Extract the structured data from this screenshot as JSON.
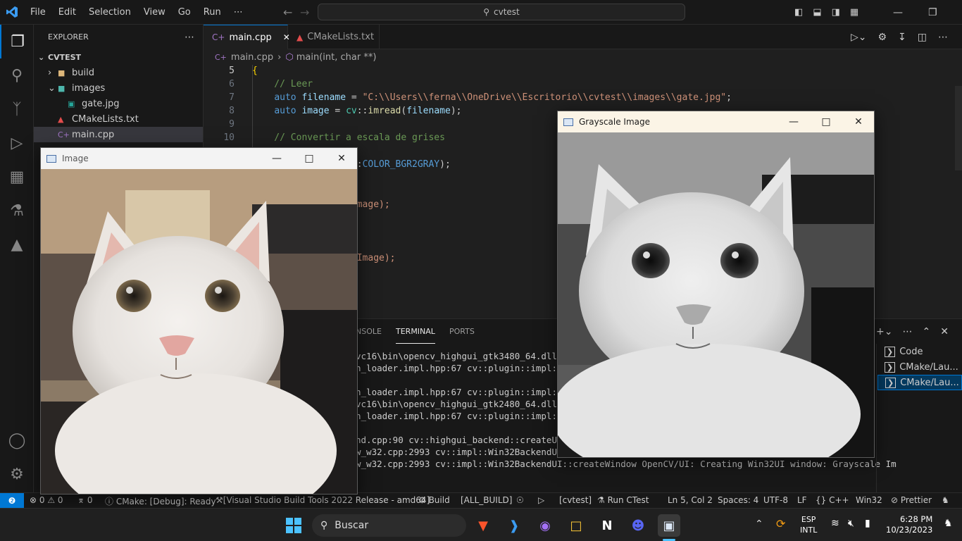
{
  "titlebar": {
    "menu": [
      "File",
      "Edit",
      "Selection",
      "View",
      "Go",
      "Run",
      "⋯"
    ],
    "search": "cvtest"
  },
  "sidebar": {
    "title": "EXPLORER",
    "root": "CVTEST",
    "items": [
      {
        "label": "build",
        "icon": "folder-icon",
        "indent": 1,
        "chevron": "›"
      },
      {
        "label": "images",
        "icon": "image-folder-icon",
        "indent": 1,
        "chevron": "⌄"
      },
      {
        "label": "gate.jpg",
        "icon": "image-file-icon",
        "indent": 2
      },
      {
        "label": "CMakeLists.txt",
        "icon": "cmake-icon",
        "indent": 1
      },
      {
        "label": "main.cpp",
        "icon": "cpp-icon",
        "indent": 1,
        "selected": true
      }
    ]
  },
  "tabs": [
    {
      "label": "main.cpp",
      "active": true
    },
    {
      "label": "CMakeLists.txt",
      "active": false
    }
  ],
  "breadcrumbs": [
    "main.cpp",
    "main(int, char **)"
  ],
  "editor": {
    "lines": [
      {
        "n": "5",
        "text": "{"
      },
      {
        "n": "6",
        "text": "    // Leer"
      },
      {
        "n": "7",
        "text": "    auto filename = \"C:\\\\Users\\\\ferna\\\\OneDrive\\\\Escritorio\\\\cvtest\\\\images\\\\gate.jpg\";"
      },
      {
        "n": "8",
        "text": "    auto image = cv::imread(filename);"
      },
      {
        "n": "9",
        "text": ""
      },
      {
        "n": "10",
        "text": "    // Convertir a escala de grises"
      },
      {
        "n": "",
        "text": "ge;"
      },
      {
        "n": "",
        "text": "age, grayImage, cv::COLOR_BGR2GRAY);"
      },
      {
        "n": "",
        "text": ""
      },
      {
        "n": "",
        "text": "o"
      },
      {
        "n": "",
        "text": "te_gris.jpg\", grayImage);"
      },
      {
        "n": "",
        "text": ""
      },
      {
        "n": "",
        "text": ""
      },
      {
        "n": "",
        "text": "ge\", image);"
      },
      {
        "n": "",
        "text": "yscale Image\", grayImage);"
      }
    ]
  },
  "panel": {
    "tabs": [
      "NSOLE",
      "TERMINAL",
      "PORTS"
    ],
    "terminal_lines": [
      "vc16\\bin\\opencv_highgui_gtk3480_64.dll =>",
      "n_loader.impl.hpp:67 cv::plugin::impl::Dy",
      "",
      "n_loader.impl.hpp:67 cv::plugin::impl::Dy",
      "vc16\\bin\\opencv_highgui_gtk2480_64.dll =>",
      "n_loader.impl.hpp:67 cv::plugin::impl::Dy",
      "",
      "nd.cpp:90 cv::highgui_backend::createUIBa",
      "w_w32.cpp:2993 cv::impl::Win32BackendUI::",
      "w_w32.cpp:2993 cv::impl::Win32BackendUI::createWindow OpenCV/UI: Creating Win32UI window: Grayscale Im"
    ],
    "terminals": [
      "Code",
      "CMake/Lau...",
      "CMake/Lau..."
    ]
  },
  "statusbar": {
    "errors": "0",
    "warnings": "0",
    "ports": "0",
    "cmake": "CMake: [Debug]: Ready",
    "kit": "[Visual Studio Build Tools 2022 Release - amd64]",
    "build": "Build",
    "target": "[ALL_BUILD]",
    "launch": "[cvtest]",
    "ctest": "Run CTest",
    "position": "Ln 5, Col 2",
    "spaces": "Spaces: 4",
    "encoding": "UTF-8",
    "eol": "LF",
    "language": "C++",
    "platform": "Win32",
    "formatter": "Prettier"
  },
  "windows": {
    "image_title": "Image",
    "gray_title": "Grayscale Image"
  },
  "taskbar": {
    "search": "Buscar",
    "lang1": "ESP",
    "lang2": "INTL",
    "time": "6:28 PM",
    "date": "10/23/2023"
  },
  "colors": {
    "accent": "#0078d4",
    "vscode_logo": "#3b9cf2"
  }
}
